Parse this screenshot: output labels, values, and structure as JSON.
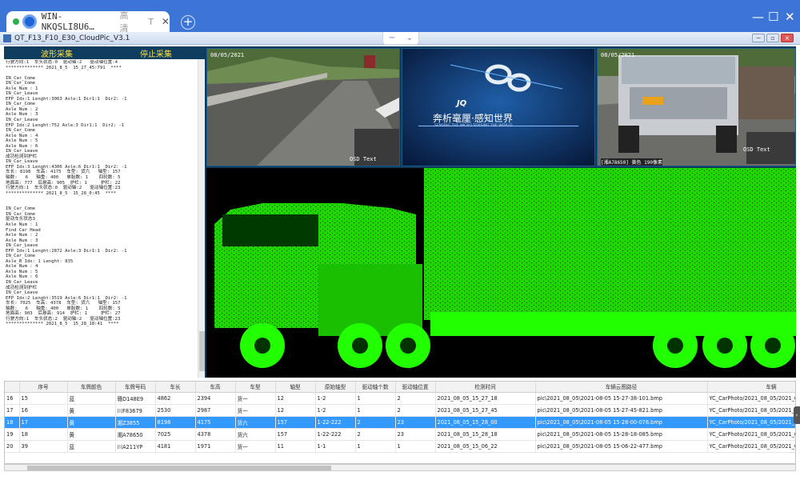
{
  "remote_session": {
    "host": "WIN-NKQSLI8U6…",
    "quality": "高清",
    "tab_marker": "T",
    "close_glyph": "✕",
    "new_tab_glyph": "+",
    "minimize_glyph": "—",
    "maximize_glyph": "☐",
    "window_close_glyph": "✕"
  },
  "app": {
    "title": "QT_F13_F10_E30_CloudPic_V3.1",
    "toolbar_minus": "−",
    "toolbar_chevron": "⌄"
  },
  "buttons": {
    "start_wave": "波形采集",
    "stop_collect": "停止采集"
  },
  "log_text": "行驶方向:1  车头状态:0  驱动轴:2   驱动轴位置:4\n************** 2021_8_5  15_27_45:791  ****\n\nIN_Car_Come\nIN_Car_Come\nAxle Num : 1\nIN_Car_Leave\nEFP Idx:1 Lenght:3063 Axle:1 Dir1:1  Dir2: -1\nIN_Car_Come\nAxle Num : 2\nAxle Num : 3\nIN_Car_Leave\nEFP Idx:2 Lenght:752 Axle:3 Dir1:1  Dir2: -1\nIN_Car_Come\nAxle Num : 4\nAxle Num : 5\nAxle Num : 6\nIN_Car_Leave\n成功检测到护栏\nIN_Car_Leave\nEFP Idx:3 Lenght:4306 Axle:6 Dir1:1  Dir2: -1\n车长: 8198  车高: 4175  车型: 货六   轴型: 157\n轴数:   6   轴重: 400   单胎数: 1    四轮数: 5\n地面高: 777  后悬高: 905  护栏: 1     护栏: 22\n行驶方向:1  车头状态:0  驱动轴:2   驱动轴位置:23\n************** 2021_8_5  15_28_0:45  ****\n\n\nIN_Car_Come\nIN_Car_Come\n驱动车头状态3\nAxle Num : 1\nFind Car Head\nAxle Num : 2\nAxle Num : 3\nIN_Car_Leave\nEFP Idx:1 Lenght:2872 Axle:3 Dir1:1  Dir2: -1\nIN_Car_Come\nAxle_B Idx: 1 Lenght: 835\nAxle Num : 4\nAxle Num : 5\nAxle Num : 6\nIN_Car_Leave\n成功检测到护栏\nIN_Car_Leave\nEFP Idx:2 Lenght:3519 Axle:6 Dir1:1  Dir2: -1\n车长: 7025  车高: 4378  车型: 货六   轴型: 157\n轴数:   6   轴重: 400   单胎数: 1    四轮数: 5\n地面高: 903  后悬高: 914  护栏: 1     护栏: 27\n行驶方向:1  车头状态:2  驱动轴:2   驱动轴位置:23\n************** 2021_8_5  15_28_18:41  ****",
  "cameras": {
    "left": {
      "timestamp": "08/05/2021",
      "label": "OSD Text"
    },
    "center": {
      "brand": "JQ",
      "slogan": "奔析毫厘·感知世界",
      "slogan_en": "SENSING THE MICRO  SENSING THE WORLD"
    },
    "right": {
      "timestamp": "08/05/2021",
      "label": "OSD Text",
      "caption": "[湘A78650] 黄色 190像素",
      "plate": "湘A78650"
    }
  },
  "pointcloud": {
    "color": "#22ff00",
    "background": "#000000"
  },
  "table": {
    "headers": [
      "",
      "序号",
      "车牌颜色",
      "车牌号码",
      "车长",
      "车高",
      "车型",
      "轴型",
      "原始轴型",
      "驱动轴个数",
      "驱动轴位置",
      "检测时间",
      "车辆云图路径",
      "车辆"
    ],
    "rows": [
      [
        "16",
        "15",
        "蓝",
        "赣D148E9",
        "4862",
        "2394",
        "货一",
        "12",
        "1-2",
        "1",
        "2",
        "2021_08_05_15_27_18",
        "pic\\2021_08_05\\2021-08-05 15-27-38-101.bmp",
        "YC_CarPhoto/2021_08_05/2021_0"
      ],
      [
        "17",
        "16",
        "黄",
        "川F83679",
        "2530",
        "2987",
        "货一",
        "12",
        "1-2",
        "1",
        "2",
        "2021_08_05_15_27_45",
        "pic\\2021_08_05\\2021-08-05 15-27-45-821.bmp",
        "YC_CarPhoto/2021_08_05/2021_0"
      ],
      [
        "18",
        "17",
        "黄",
        "湘Z3855",
        "8198",
        "4175",
        "货六",
        "157",
        "1-22-222",
        "2",
        "23",
        "2021_08_05_15_28_00",
        "pic\\2021_08_05\\2021-08-05 15-28-00-076.bmp",
        "YC_CarPhoto/2021_08_05/2021_0"
      ],
      [
        "19",
        "18",
        "黄",
        "湘A78650",
        "7025",
        "4378",
        "货六",
        "157",
        "1-22-222",
        "2",
        "23",
        "2021_08_05_15_28_18",
        "pic\\2021_08_05\\2021-08-05 15-28-18-085.bmp",
        "YC_CarPhoto/2021_08_05/2021_0"
      ],
      [
        "20",
        "39",
        "蓝",
        "川A211YP",
        "4181",
        "1971",
        "货一",
        "11",
        "1-1",
        "1",
        "1",
        "2021_08_05_15_06_22",
        "pic\\2021_08_05\\2021-08-05 15-06-22-477.bmp",
        "YC_CarPhoto/2021_08_05/2021_0"
      ]
    ],
    "selected_row_index": 2
  },
  "colors": {
    "accent": "#3d75d6",
    "selection": "#3399ff",
    "button_text": "#ffe03a",
    "panel_bg": "#0d3b5e"
  }
}
